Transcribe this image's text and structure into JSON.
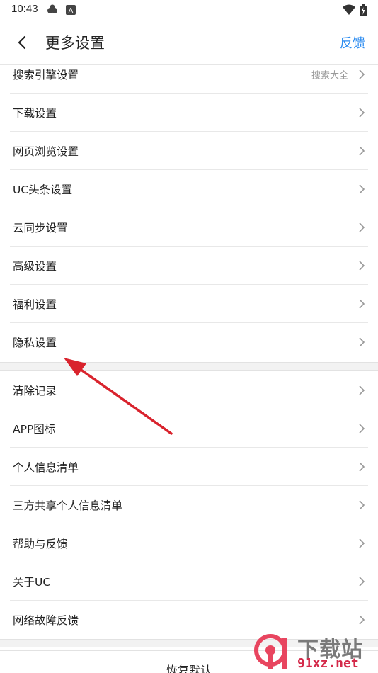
{
  "status_bar": {
    "time": "10:43"
  },
  "header": {
    "title": "更多设置",
    "feedback_label": "反馈"
  },
  "group1": {
    "items": [
      {
        "label": "搜索引擎设置",
        "value": "搜索大全"
      },
      {
        "label": "下载设置"
      },
      {
        "label": "网页浏览设置"
      },
      {
        "label": "UC头条设置"
      },
      {
        "label": "云同步设置"
      },
      {
        "label": "高级设置"
      },
      {
        "label": "福利设置"
      },
      {
        "label": "隐私设置"
      }
    ]
  },
  "group2": {
    "items": [
      {
        "label": "清除记录"
      },
      {
        "label": "APP图标"
      },
      {
        "label": "个人信息清单"
      },
      {
        "label": "三方共享个人信息清单"
      },
      {
        "label": "帮助与反馈"
      },
      {
        "label": "关于UC"
      },
      {
        "label": "网络故障反馈"
      }
    ]
  },
  "footer": {
    "restore_label": "恢复默认"
  },
  "watermark": {
    "title": "下载站",
    "url": "91xz.net"
  },
  "colors": {
    "accent": "#2d8cf0",
    "annotation": "#d9232d"
  }
}
